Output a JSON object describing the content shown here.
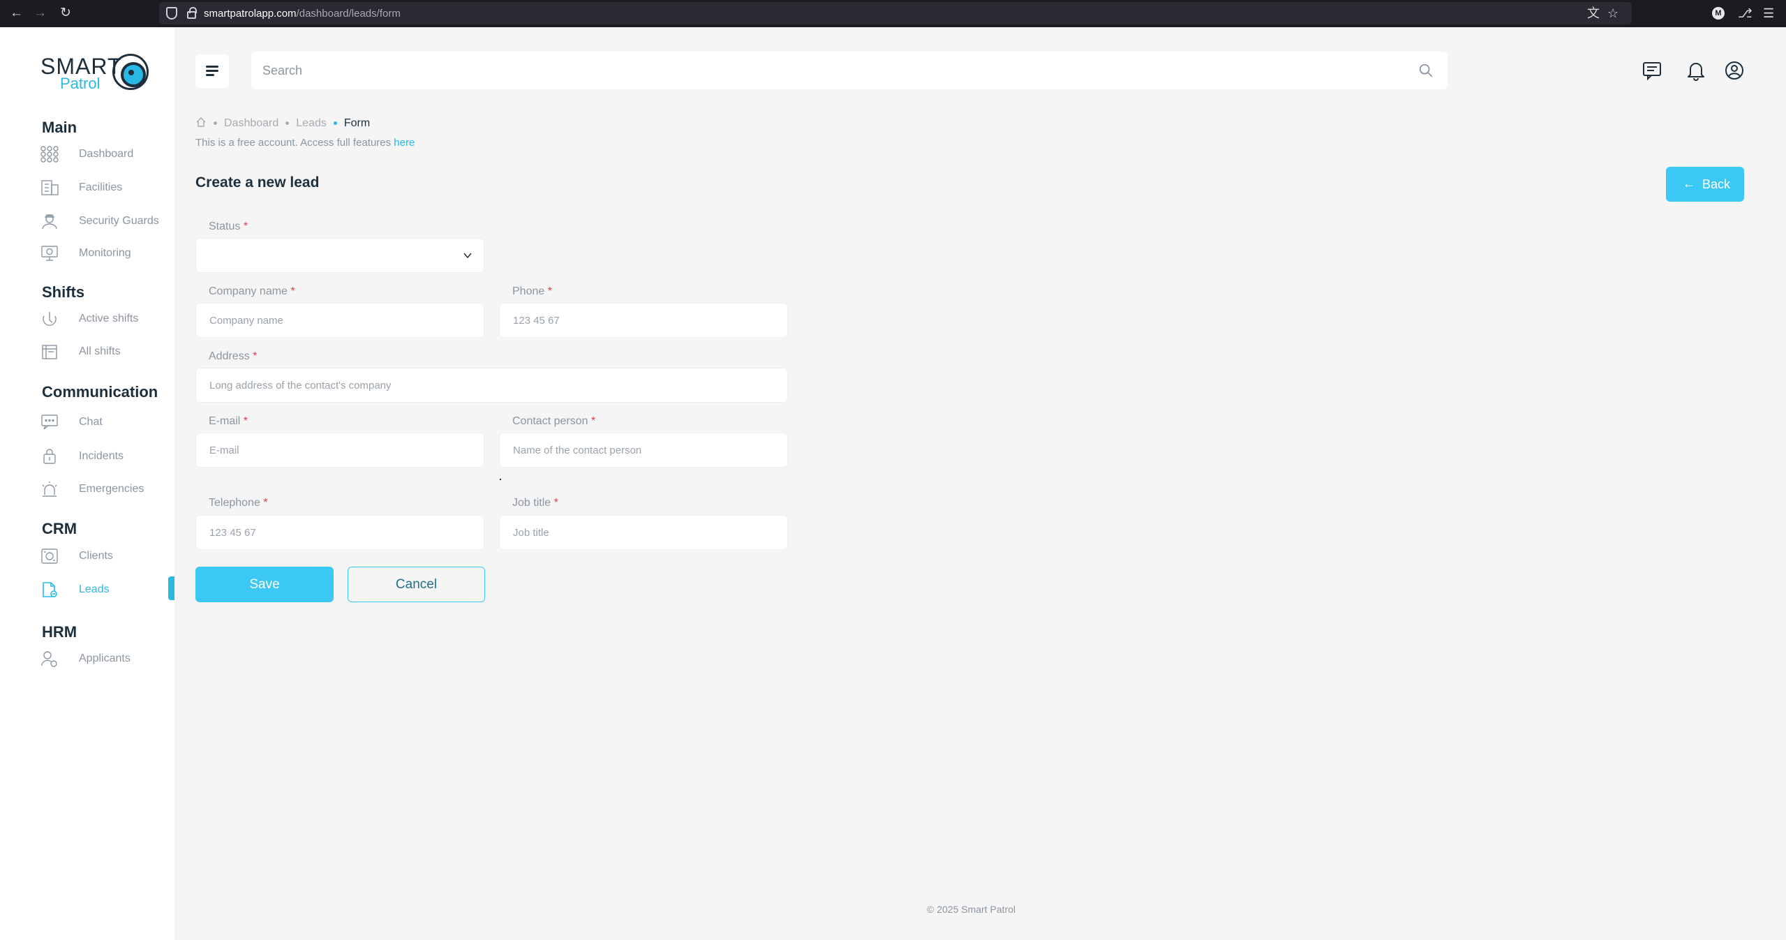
{
  "browser": {
    "url_host": "smartpatrolapp.com",
    "url_path": "/dashboard/leads/form",
    "profile_initial": "M"
  },
  "logo": {
    "smart": "SMART",
    "patrol": "Patrol"
  },
  "sidebar": {
    "sections": [
      {
        "title": "Main",
        "items": [
          {
            "label": "Dashboard",
            "icon": "grid-icon"
          },
          {
            "label": "Facilities",
            "icon": "building-icon"
          },
          {
            "label": "Security Guards",
            "icon": "guard-icon"
          },
          {
            "label": "Monitoring",
            "icon": "monitor-icon"
          }
        ]
      },
      {
        "title": "Shifts",
        "items": [
          {
            "label": "Active shifts",
            "icon": "clock-icon"
          },
          {
            "label": "All shifts",
            "icon": "calendar-icon"
          }
        ]
      },
      {
        "title": "Communication",
        "items": [
          {
            "label": "Chat",
            "icon": "chat-icon"
          },
          {
            "label": "Incidents",
            "icon": "incident-icon"
          },
          {
            "label": "Emergencies",
            "icon": "siren-icon"
          }
        ]
      },
      {
        "title": "CRM",
        "items": [
          {
            "label": "Clients",
            "icon": "money-icon"
          },
          {
            "label": "Leads",
            "icon": "lead-doc-icon",
            "active": true
          }
        ]
      },
      {
        "title": "HRM",
        "items": [
          {
            "label": "Applicants",
            "icon": "applicant-icon"
          }
        ]
      }
    ]
  },
  "topbar": {
    "search_placeholder": "Search"
  },
  "breadcrumb": [
    "Dashboard",
    "Leads",
    "Form"
  ],
  "notice": {
    "text": "This is a free account. Access full features ",
    "link": "here"
  },
  "page": {
    "title": "Create a new lead",
    "back_label": "Back"
  },
  "form": {
    "status": {
      "label": "Status",
      "value": ""
    },
    "company_name": {
      "label": "Company name",
      "placeholder": "Company name"
    },
    "phone": {
      "label": "Phone",
      "placeholder": "123 45 67"
    },
    "address": {
      "label": "Address",
      "placeholder": "Long address of the contact's company"
    },
    "email": {
      "label": "E-mail",
      "placeholder": "E-mail"
    },
    "contact_person": {
      "label": "Contact person",
      "placeholder": "Name of the contact person"
    },
    "telephone": {
      "label": "Telephone",
      "placeholder": "123 45 67"
    },
    "job_title": {
      "label": "Job title",
      "placeholder": "Job title"
    },
    "required_mark": "*",
    "save_label": "Save",
    "cancel_label": "Cancel"
  },
  "footer": "© 2025 Smart Patrol",
  "colors": {
    "accent": "#3cc8f4",
    "text": "#1d2f3d",
    "muted": "#8c96a0",
    "required": "#e53b4e"
  }
}
